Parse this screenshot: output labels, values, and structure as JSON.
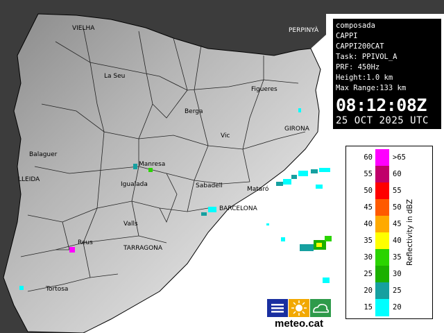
{
  "info": {
    "lines": [
      "composada",
      "CAPPI",
      "CAPPI200CAT",
      "Task: PPIVOL_A",
      "PRF: 450Hz",
      "Height:1.0 km",
      "Max Range:133 km"
    ],
    "time": "08:12:08Z",
    "date": "25 OCT 2025 UTC"
  },
  "legend": {
    "title": "Reflectivity in dBZ",
    "rows": [
      {
        "left": "60",
        "right": ">65",
        "color": "#ff00ff"
      },
      {
        "left": "55",
        "right": "60",
        "color": "#c0006a"
      },
      {
        "left": "50",
        "right": "55",
        "color": "#ff0000"
      },
      {
        "left": "45",
        "right": "50",
        "color": "#ff5a00"
      },
      {
        "left": "40",
        "right": "45",
        "color": "#ffaa00"
      },
      {
        "left": "35",
        "right": "40",
        "color": "#ffff00"
      },
      {
        "left": "30",
        "right": "35",
        "color": "#2ad400"
      },
      {
        "left": "25",
        "right": "30",
        "color": "#1bb000"
      },
      {
        "left": "20",
        "right": "25",
        "color": "#16a0a0"
      },
      {
        "left": "15",
        "right": "20",
        "color": "#00ffff"
      }
    ]
  },
  "places": [
    {
      "name": "VIELHA",
      "kind": "town"
    },
    {
      "name": "PERPINYÀ",
      "kind": "city"
    },
    {
      "name": "La Seu",
      "kind": "town"
    },
    {
      "name": "Figueres",
      "kind": "town"
    },
    {
      "name": "Berga",
      "kind": "town"
    },
    {
      "name": "GIRONA",
      "kind": "city"
    },
    {
      "name": "Vic",
      "kind": "town"
    },
    {
      "name": "Balaguer",
      "kind": "town"
    },
    {
      "name": "Manresa",
      "kind": "town"
    },
    {
      "name": "LLEIDA",
      "kind": "city"
    },
    {
      "name": "Igualada",
      "kind": "town"
    },
    {
      "name": "Sabadell",
      "kind": "town"
    },
    {
      "name": "Mataró",
      "kind": "town"
    },
    {
      "name": "BARCELONA",
      "kind": "city"
    },
    {
      "name": "Valls",
      "kind": "town"
    },
    {
      "name": "Reus",
      "kind": "town"
    },
    {
      "name": "TARRAGONA",
      "kind": "city"
    },
    {
      "name": "Tortosa",
      "kind": "town"
    }
  ],
  "logo": {
    "text": "meteo.cat",
    "icons": [
      "lines-icon",
      "sun-icon",
      "cloud-icon"
    ]
  },
  "colors": {
    "sea": "#ffffff",
    "land_frame": "#000000",
    "radar_cyan": "#00ffff"
  }
}
